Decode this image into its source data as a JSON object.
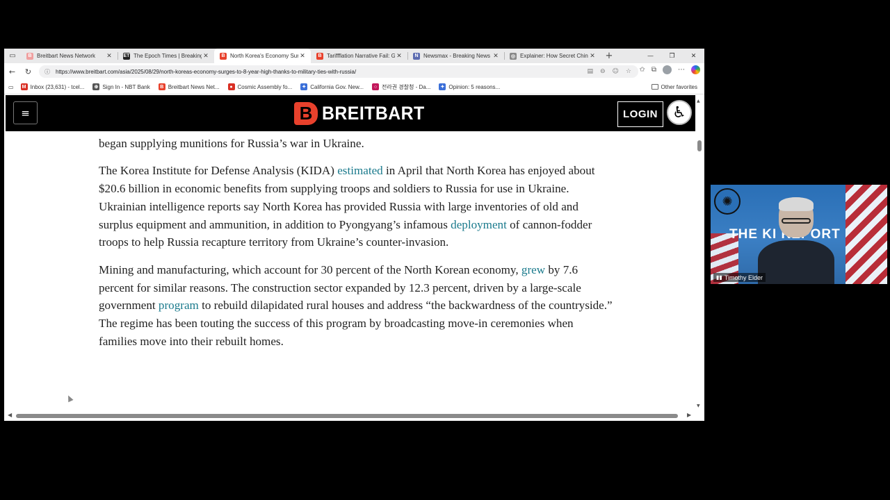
{
  "tabs": [
    {
      "title": "Breitbart News Network",
      "icon": "B",
      "color": "#f0a0a0",
      "active": false
    },
    {
      "title": "The Epoch Times | Breaking",
      "icon": "ET",
      "color": "#222222",
      "active": false
    },
    {
      "title": "North Korea's Economy Surg",
      "icon": "B",
      "color": "#e8412c",
      "active": true
    },
    {
      "title": "Tariffflation Narrative Fail: Go",
      "icon": "B",
      "color": "#e8412c",
      "active": false
    },
    {
      "title": "Newsmax - Breaking News |",
      "icon": "N",
      "color": "#5b6bb0",
      "active": false
    },
    {
      "title": "Explainer: How Secret Chinc",
      "icon": "◎",
      "color": "#888888",
      "active": false
    }
  ],
  "tab_close": "✕",
  "new_tab": "+",
  "window_controls": {
    "minimize": "—",
    "maximize": "❐",
    "close": "✕"
  },
  "url": "https://www.breitbart.com/asia/2025/08/29/north-koreas-economy-surges-to-8-year-high-thanks-to-military-ties-with-russia/",
  "bookmarks": [
    {
      "label": "Inbox (23,631) - tcel...",
      "icon": "M",
      "color": "#d93025"
    },
    {
      "label": "Sign In - NBT Bank",
      "icon": "⊕",
      "color": "#555555"
    },
    {
      "label": "Breitbart News Net...",
      "icon": "B",
      "color": "#e8412c"
    },
    {
      "label": "Cosmic Assembly fo...",
      "icon": "●",
      "color": "#d93025"
    },
    {
      "label": "California Gov. New...",
      "icon": "✦",
      "color": "#3b6fd8"
    },
    {
      "label": "전라권 경찰청 - Da...",
      "icon": "○",
      "color": "#c2185b"
    },
    {
      "label": "Opinion: 5 reasons...",
      "icon": "✦",
      "color": "#3b6fd8"
    }
  ],
  "other_favorites": "Other favorites",
  "site": {
    "logo_letter": "B",
    "logo_text": "BREITBART",
    "login": "LOGIN",
    "accent": "#e8412c"
  },
  "article": {
    "p1": "began supplying munitions for Russia’s war in Ukraine.",
    "p2": {
      "a": "The Korea Institute for Defense Analysis (KIDA) ",
      "link1": "estimated",
      "b": " in April that North Korea has enjoyed about $20.6 billion in economic benefits from supplying troops and soldiers to Russia for use in Ukraine. Ukrainian intelligence reports say North Korea has provided Russia with large inventories of old and surplus equipment and ammunition, in addition to Pyongyang’s infamous ",
      "link2": "deployment",
      "c": " of cannon-fodder troops to help Russia recapture territory from Ukraine’s counter-invasion."
    },
    "p3": {
      "a": "Mining and manufacturing, which account for 30 percent of the North Korean economy, ",
      "link1": "grew",
      "b": " by 7.6 percent for similar reasons. The construction sector expanded by 12.3 percent, driven by a large-scale government ",
      "link2": "program",
      "c": " to rebuild dilapidated rural houses and address “the backwardness of the countryside.” The regime has been touting the success of this program by broadcasting move-in ceremonies when families move into their rebuilt homes."
    }
  },
  "video": {
    "title": "THE KI    REPORT",
    "name": "Timothy Elder"
  }
}
